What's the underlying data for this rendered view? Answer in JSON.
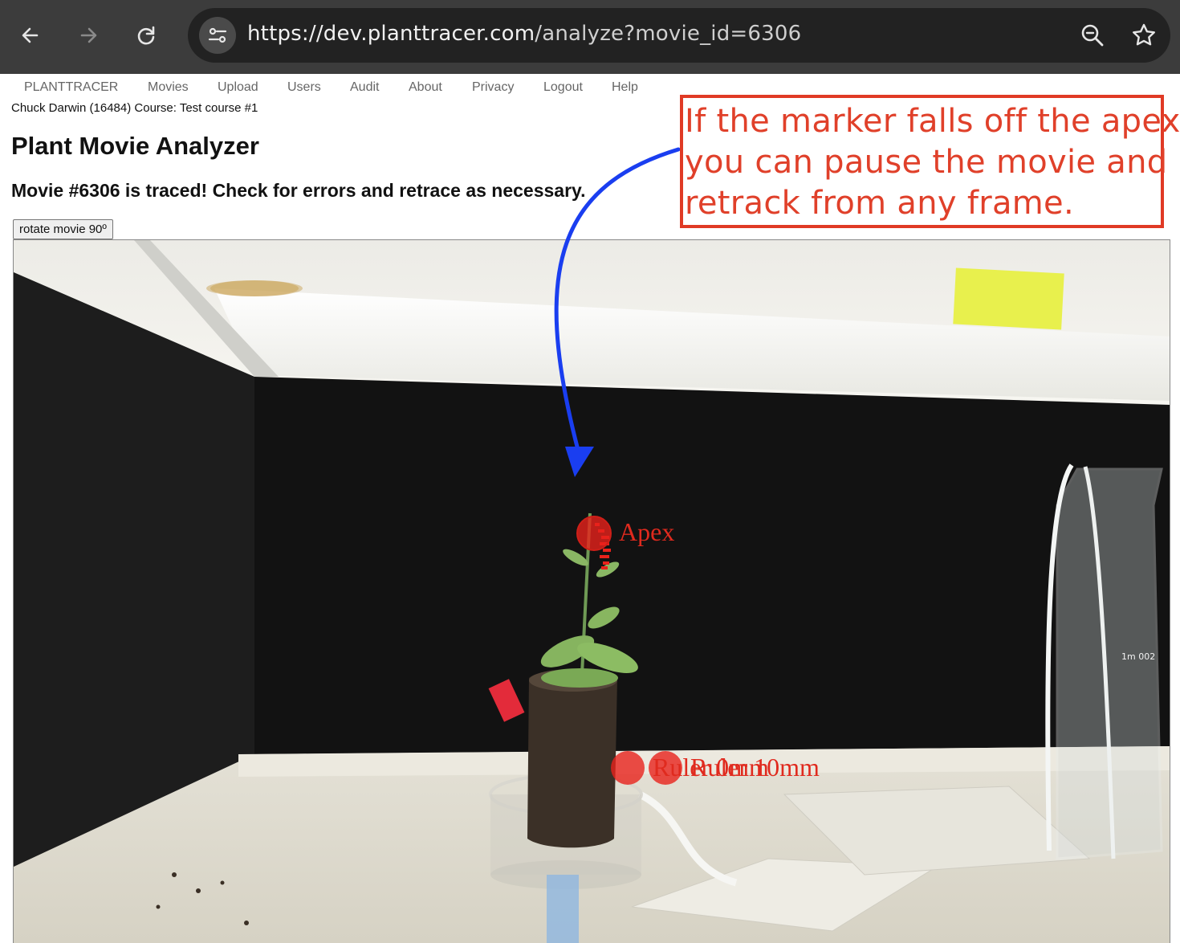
{
  "browser": {
    "url_host": "https://dev.planttracer.com",
    "url_path": "/analyze?movie_id=6306",
    "icons": [
      "back-arrow-icon",
      "forward-arrow-icon",
      "reload-icon",
      "site-settings-icon",
      "zoom-icon",
      "bookmark-star-icon"
    ]
  },
  "menu": {
    "items": [
      "PLANTTRACER",
      "Movies",
      "Upload",
      "Users",
      "Audit",
      "About",
      "Privacy",
      "Logout",
      "Help"
    ]
  },
  "user_info": "Chuck Darwin (16484) Course: Test course #1",
  "page": {
    "title": "Plant Movie Analyzer",
    "status": "Movie #6306 is traced! Check for errors and retrace as necessary.",
    "rotate_label": "rotate movie 90º"
  },
  "movie": {
    "markers": [
      {
        "label": "Apex"
      },
      {
        "label": "Ruler 0mm"
      },
      {
        "label": "Ruler 10mm"
      }
    ],
    "scale_text": "1m 002",
    "colors": {
      "marker": "#e8221b",
      "marker_label": "#e02a1e"
    }
  },
  "annotation": {
    "lines": [
      "If the marker falls off the apex",
      "you can pause the movie and",
      "retrack from any frame."
    ],
    "colors": {
      "box": "#e03a25",
      "arrow": "#1a3ef0"
    }
  }
}
